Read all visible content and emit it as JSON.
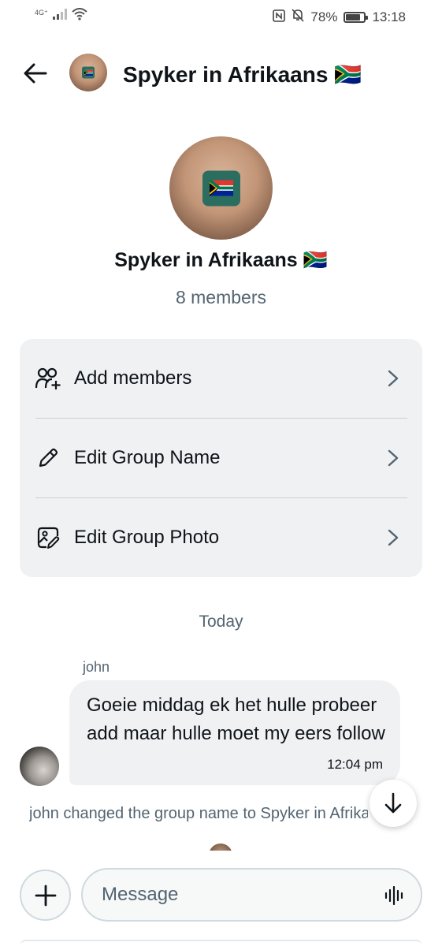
{
  "status_bar": {
    "network": "4G⁺",
    "battery": "78%",
    "battery_level": 0.78,
    "time": "13:18",
    "icons": [
      "signal-icon",
      "wifi-icon",
      "nfc-icon",
      "mute-icon",
      "battery-icon"
    ]
  },
  "header": {
    "title": "Spyker in Afrikaans 🇿🇦",
    "back_icon": "arrow-left-icon"
  },
  "group": {
    "name": "Spyker in Afrikaans 🇿🇦",
    "members": "8 members"
  },
  "actions": [
    {
      "label": "Add members",
      "icon": "add-members-icon"
    },
    {
      "label": "Edit Group Name",
      "icon": "pencil-icon"
    },
    {
      "label": "Edit Group Photo",
      "icon": "edit-photo-icon"
    }
  ],
  "chat": {
    "day": "Today",
    "messages": [
      {
        "sender": "john",
        "text": "Goeie middag ek het hulle probeer add maar hulle moet my eers follow",
        "time": "12:04 pm"
      }
    ],
    "system_message": "john changed the group name to Spyker in Afrikaans 🇿🇦"
  },
  "composer": {
    "placeholder": "Message"
  },
  "colors": {
    "text_primary": "#0f1419",
    "text_secondary": "#536471",
    "card_bg": "#eff1f3",
    "badge_green": "#2b6d5f"
  }
}
